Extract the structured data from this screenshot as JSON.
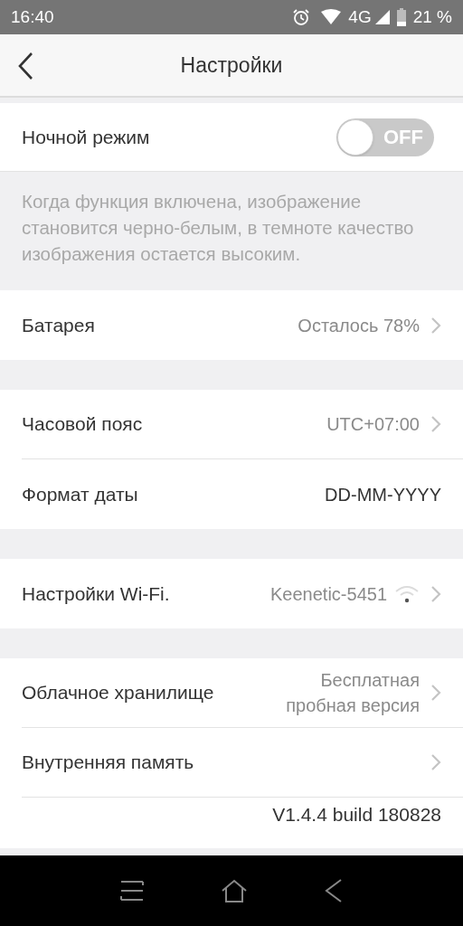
{
  "status_bar": {
    "time": "16:40",
    "network": "4G",
    "battery": "21 %"
  },
  "header": {
    "title": "Настройки"
  },
  "night_mode": {
    "label": "Ночной режим",
    "toggle_text": "OFF",
    "on": false
  },
  "night_mode_note": "Когда функция включена, изображение становится черно-белым,  в темноте качество изображения остается высоким.",
  "groups": [
    {
      "rows": [
        {
          "kind": "link",
          "label": "Батарея",
          "value": "Осталось 78%"
        }
      ]
    },
    {
      "rows": [
        {
          "kind": "link",
          "label": "Часовой пояс",
          "value": "UTC+07:00"
        },
        {
          "kind": "plain",
          "label": "Формат даты",
          "value": "DD-MM-YYYY"
        }
      ]
    },
    {
      "rows": [
        {
          "kind": "wifi",
          "label": "Настройки Wi-Fi.",
          "value": "Keenetic-5451"
        }
      ]
    },
    {
      "rows": [
        {
          "kind": "link",
          "label": "Облачное хранилище",
          "value": "Бесплатная пробная версия"
        },
        {
          "kind": "link",
          "label": "Внутренняя память"
        },
        {
          "kind": "version",
          "value": "V1.4.4 build 180828"
        }
      ]
    }
  ]
}
